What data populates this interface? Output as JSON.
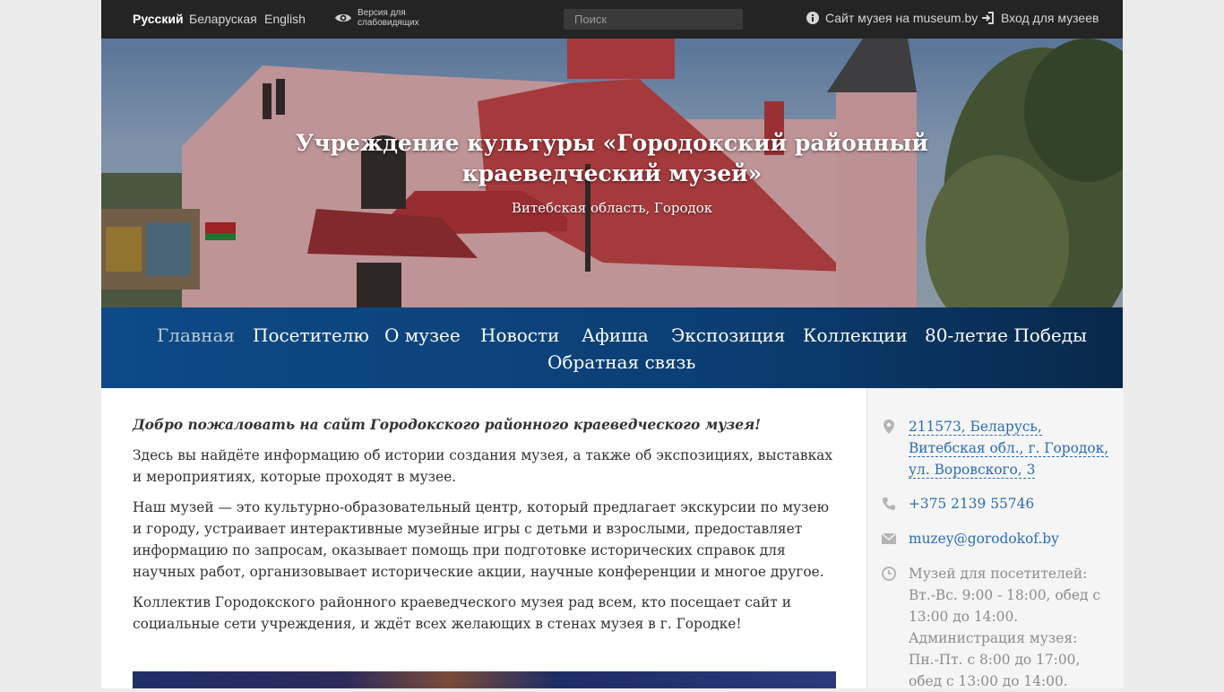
{
  "topbar": {
    "languages": [
      {
        "label": "Русский",
        "active": true
      },
      {
        "label": "Беларуская",
        "active": false
      },
      {
        "label": "English",
        "active": false
      }
    ],
    "low_vision": "Версия для слабовидящих",
    "search_placeholder": "Поиск",
    "museum_site_link": "Сайт музея на museum.by",
    "login_link": "Вход для музеев"
  },
  "hero": {
    "title_line1": "Учреждение культуры «Городокский районный",
    "title_line2": "краеведческий музей»",
    "subtitle": "Витебская область, Городок"
  },
  "nav": {
    "items": [
      {
        "label": "Главная",
        "current": true
      },
      {
        "label": "Посетителю"
      },
      {
        "label": "О музее"
      },
      {
        "label": "Новости"
      },
      {
        "label": "Афиша"
      },
      {
        "label": "Экспозиция"
      },
      {
        "label": "Коллекции"
      },
      {
        "label": "80-летие Победы"
      },
      {
        "label": "Обратная связь"
      }
    ]
  },
  "main": {
    "welcome": "Добро пожаловать на сайт Городокского районного краеведческого музея!",
    "p1": "Здесь вы найдёте информацию об истории создания музея, а также об экспозициях, выставках и мероприятиях, которые проходят в музее.",
    "p2": "Наш музей — это культурно-образовательный центр, который предлагает экскурсии по музею и городу, устраивает интерактивные музейные игры с детьми и взрослыми, предоставляет информацию по запросам, оказывает помощь при подготовке исторических справок для научных работ, организовывает исторические акции, научные конференции и многое другое.",
    "p3": "Коллектив Городокского районного краеведческого музея рад всем, кто посещает сайт и социальные сети учреждения, и ждёт всех желающих в стенах музея в г. Городке!"
  },
  "sidebar": {
    "address": "211573, Беларусь, Витебская обл., г. Городок, ул. Воровского, 3",
    "phone": "+375 2139 55746",
    "email": "muzey@gorodokof.by",
    "hours": "Музей для посетителей: Вт.-Вс. 9:00 - 18:00, обед с 13:00 до 14:00. Администрация музея: Пн.-Пт. с 8:00 до 17:00, обед с 13:00 до 14:00."
  },
  "icons": [
    "eye-icon",
    "info-icon",
    "login-icon",
    "map-marker-icon",
    "phone-icon",
    "envelope-icon",
    "clock-icon"
  ],
  "colors": {
    "topbar": "#242424",
    "nav": "#0d4a87",
    "link": "#2a6db3"
  }
}
